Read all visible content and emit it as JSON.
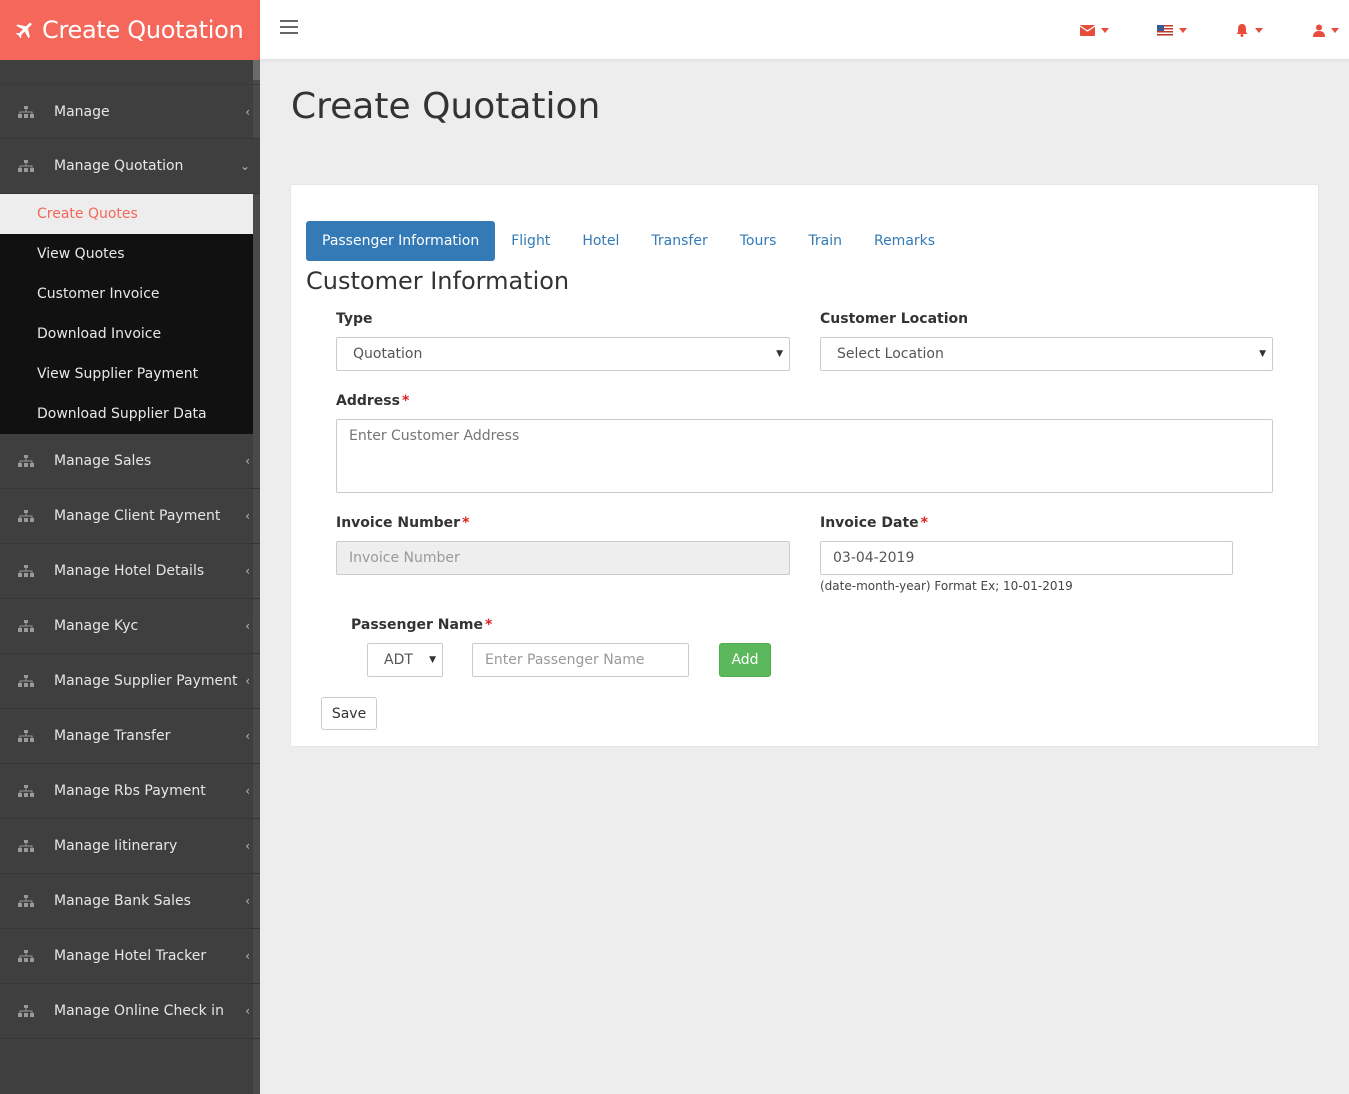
{
  "brand": {
    "title": "Create Quotation",
    "color": "#f4675a"
  },
  "sidebar": {
    "items_top": [
      {
        "label": "Manage"
      },
      {
        "label": "Manage Quotation"
      }
    ],
    "submenu": [
      {
        "label": "Create Quotes",
        "active": true
      },
      {
        "label": "View Quotes"
      },
      {
        "label": "Customer Invoice"
      },
      {
        "label": "Download Invoice"
      },
      {
        "label": "View Supplier Payment"
      },
      {
        "label": "Download Supplier Data"
      }
    ],
    "items_bottom": [
      {
        "label": "Manage Sales"
      },
      {
        "label": "Manage Client Payment"
      },
      {
        "label": "Manage Hotel Details"
      },
      {
        "label": "Manage Kyc"
      },
      {
        "label": "Manage Supplier Payment"
      },
      {
        "label": "Manage Transfer"
      },
      {
        "label": "Manage Rbs Payment"
      },
      {
        "label": "Manage Iitinerary"
      },
      {
        "label": "Manage Bank Sales"
      },
      {
        "label": "Manage Hotel Tracker"
      },
      {
        "label": "Manage Online Check in"
      }
    ]
  },
  "topbar": {
    "icons": [
      "envelope-icon",
      "flag-icon",
      "bell-icon",
      "user-icon"
    ]
  },
  "page": {
    "title": "Create Quotation"
  },
  "tabs": [
    {
      "label": "Passenger Information",
      "active": true
    },
    {
      "label": "Flight"
    },
    {
      "label": "Hotel"
    },
    {
      "label": "Transfer"
    },
    {
      "label": "Tours"
    },
    {
      "label": "Train"
    },
    {
      "label": "Remarks"
    }
  ],
  "form": {
    "section_title": "Customer Information",
    "type": {
      "label": "Type",
      "value": "Quotation"
    },
    "customer_location": {
      "label": "Customer Location",
      "value": "Select Location"
    },
    "address": {
      "label": "Address",
      "required": "*",
      "placeholder": "Enter Customer Address"
    },
    "invoice_number": {
      "label": "Invoice Number",
      "required": "*",
      "placeholder": "Invoice Number"
    },
    "invoice_date": {
      "label": "Invoice Date",
      "required": "*",
      "value": "03-04-2019",
      "hint": "(date-month-year) Format Ex; 10-01-2019"
    },
    "passenger_name": {
      "label": "Passenger Name",
      "required": "*",
      "type_value": "ADT",
      "placeholder": "Enter Passenger Name",
      "add_label": "Add"
    },
    "save_label": "Save"
  }
}
